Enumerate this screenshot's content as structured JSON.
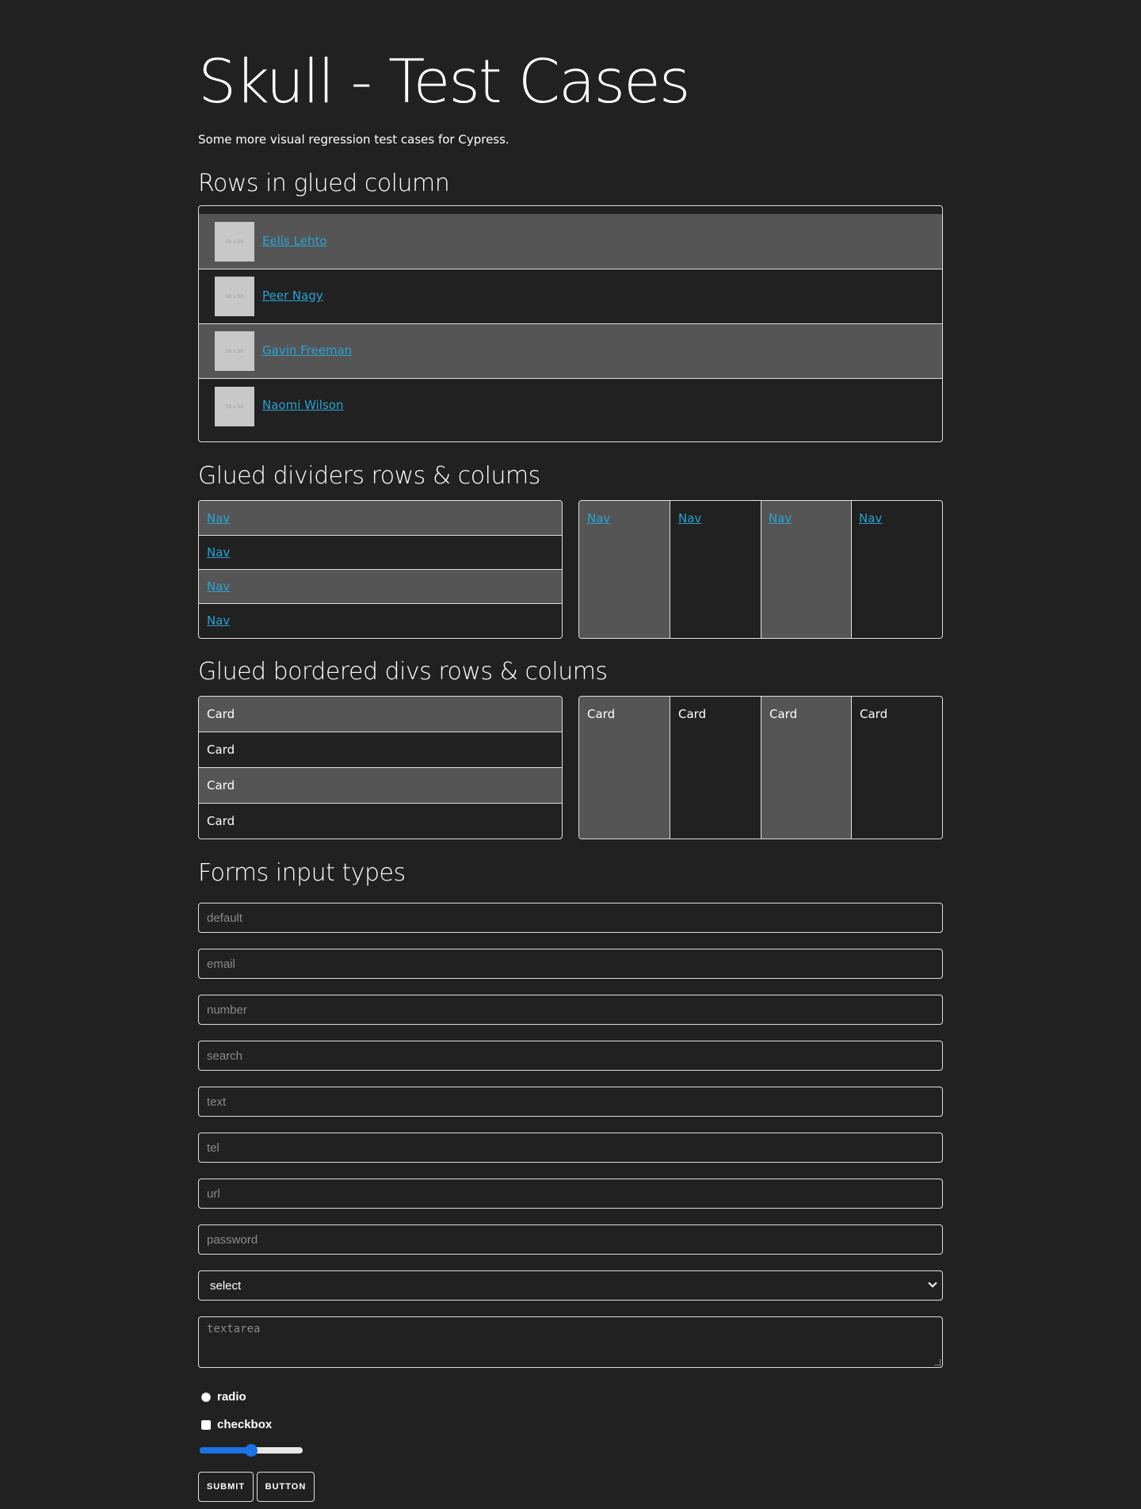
{
  "page": {
    "title": "Skull - Test Cases",
    "intro": "Some more visual regression test cases for Cypress."
  },
  "sections": {
    "glued_column_title": "Rows in glued column",
    "dividers_title": "Glued dividers rows & colums",
    "bordered_title": "Glued bordered divs rows & colums",
    "forms_title": "Forms input types"
  },
  "users": [
    {
      "name": "Eelis Lehto",
      "thumb": "50 x 50"
    },
    {
      "name": "Peer Nagy",
      "thumb": "50 x 50"
    },
    {
      "name": "Gavin Freeman",
      "thumb": "50 x 50"
    },
    {
      "name": "Naomi Wilson",
      "thumb": "50 x 50"
    }
  ],
  "nav_rows": [
    "Nav",
    "Nav",
    "Nav",
    "Nav"
  ],
  "nav_cols": [
    "Nav",
    "Nav",
    "Nav",
    "Nav"
  ],
  "card_rows": [
    "Card",
    "Card",
    "Card",
    "Card"
  ],
  "card_cols": [
    "Card",
    "Card",
    "Card",
    "Card"
  ],
  "form": {
    "inputs": [
      "default",
      "email",
      "number",
      "search",
      "text",
      "tel",
      "url",
      "password"
    ],
    "select_value": "select",
    "textarea_placeholder": "textarea",
    "radio_label": "radio",
    "checkbox_label": "checkbox",
    "range_value_percent": 50,
    "submit_label": "SUBMIT",
    "button_label": "BUTTON"
  },
  "colors": {
    "background": "#212121",
    "shaded_row": "#555555",
    "link": "#29a3d4",
    "border": "#e0e0e0",
    "accent": "#1a73e8"
  }
}
